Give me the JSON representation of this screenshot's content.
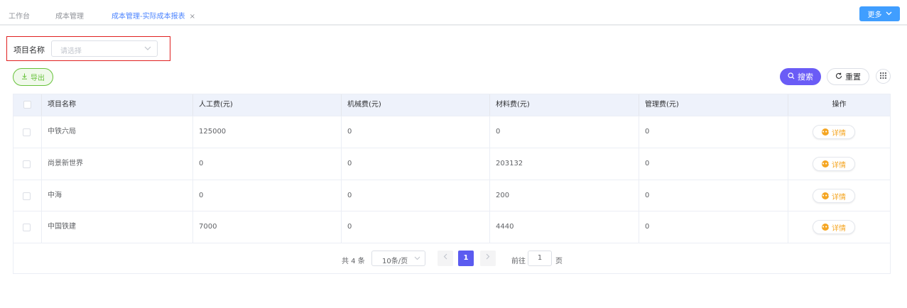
{
  "tabs": [
    {
      "label": "工作台"
    },
    {
      "label": "成本管理"
    },
    {
      "label": "成本管理-实际成本报表",
      "close": "×"
    }
  ],
  "more_button": {
    "label": "更多",
    "icon": "chevron-down-icon"
  },
  "filter": {
    "label": "项目名称",
    "placeholder": "请选择"
  },
  "toolbar": {
    "export_label": "导出",
    "search_label": "搜索",
    "reset_label": "重置"
  },
  "table": {
    "columns": [
      "项目名称",
      "人工费(元)",
      "机械费(元)",
      "材料费(元)",
      "管理费(元)",
      "操作"
    ],
    "rows": [
      {
        "name": "中铁六局",
        "labor": "125000",
        "machine": "0",
        "material": "0",
        "manage": "0",
        "action": "详情"
      },
      {
        "name": "尚景新世界",
        "labor": "0",
        "machine": "0",
        "material": "203132",
        "manage": "0",
        "action": "详情"
      },
      {
        "name": "中海",
        "labor": "0",
        "machine": "0",
        "material": "200",
        "manage": "0",
        "action": "详情"
      },
      {
        "name": "中国铁建",
        "labor": "7000",
        "machine": "0",
        "material": "4440",
        "manage": "0",
        "action": "详情"
      }
    ]
  },
  "pagination": {
    "total": "共 4 条",
    "page_size": "10条/页",
    "current": "1",
    "goto_label": "前往",
    "goto_value": "1",
    "goto_unit": "页"
  },
  "colors": {
    "accent": "#409eff",
    "search": "#6a5cf6",
    "export": "#67c23a",
    "detail": "#f5a623",
    "highlight_border": "#e02020"
  }
}
